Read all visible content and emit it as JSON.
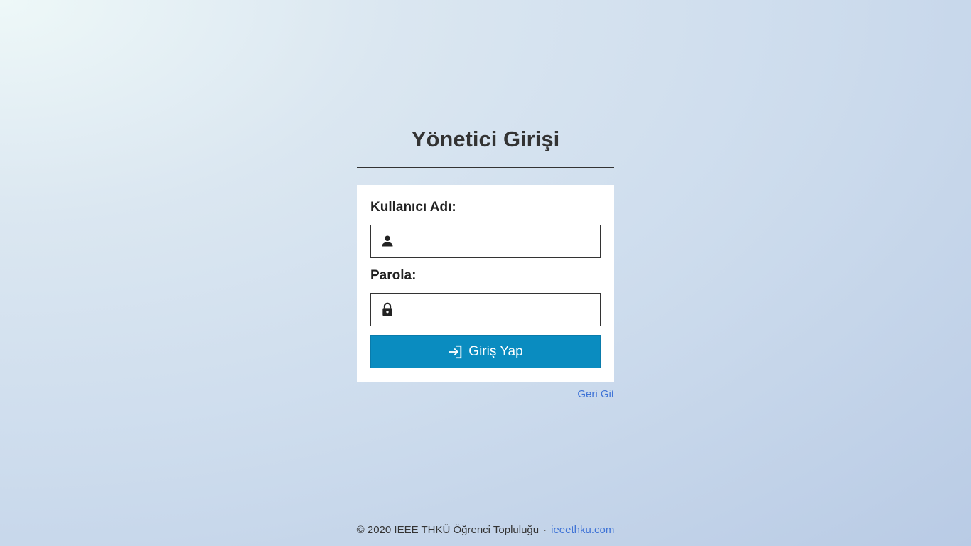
{
  "page": {
    "title": "Yönetici Girişi"
  },
  "form": {
    "username_label": "Kullanıcı Adı:",
    "username_value": "",
    "username_placeholder": "",
    "username_icon": "person-icon",
    "password_label": "Parola:",
    "password_value": "",
    "password_placeholder": "",
    "password_icon": "lock-icon",
    "submit_label": "Giriş Yap",
    "submit_icon": "login-arrow-icon"
  },
  "links": {
    "back_label": "Geri Git"
  },
  "footer": {
    "copyright": "© 2020 IEEE THKÜ Öğrenci Topluluğu",
    "separator": "·",
    "site_link": "ieeethku.com"
  },
  "colors": {
    "accent": "#0a8cc0",
    "link": "#3f73d6",
    "text": "#333333",
    "card_bg": "#ffffff"
  }
}
